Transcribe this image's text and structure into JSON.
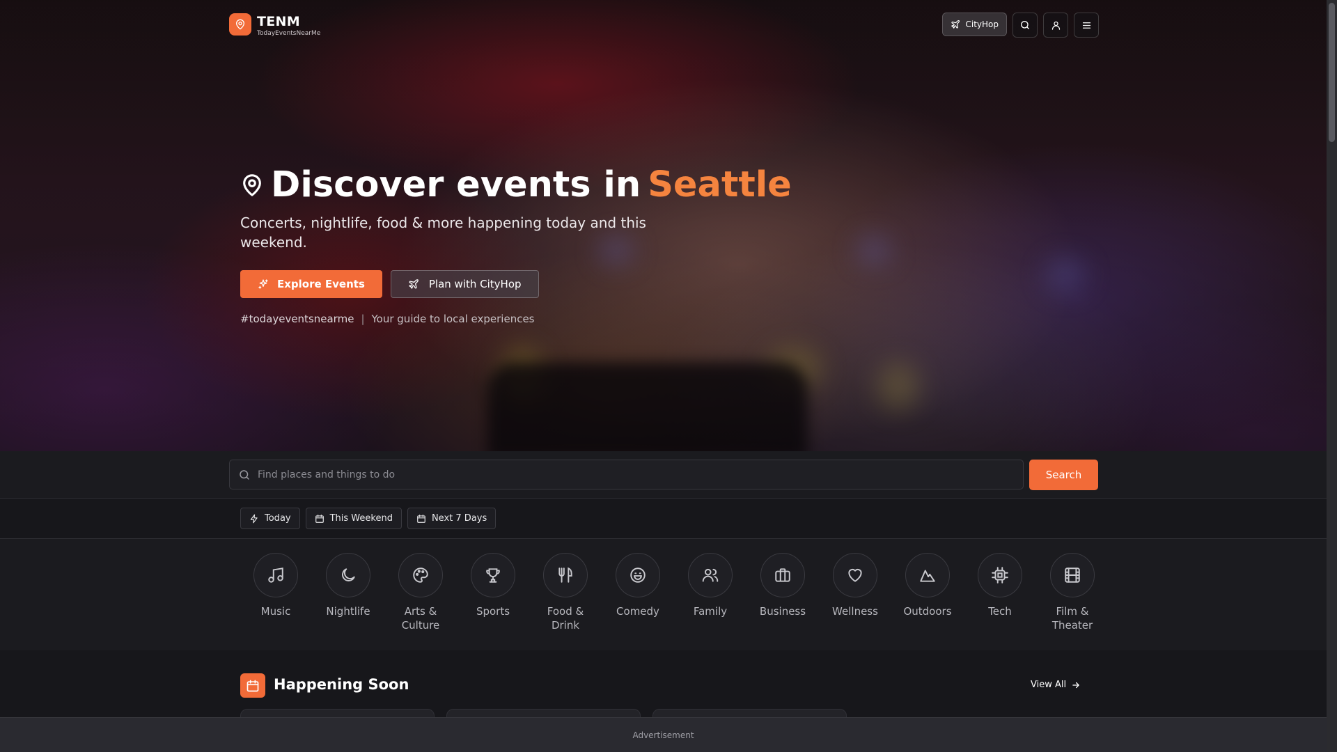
{
  "brand": {
    "name": "TENM",
    "tagline": "TodayEventsNearMe"
  },
  "header": {
    "cityhop_label": "CityHop"
  },
  "hero": {
    "title_prefix": "Discover events in",
    "city": "Seattle",
    "subtitle": "Concerts, nightlife, food & more happening today and this weekend.",
    "explore_label": "Explore Events",
    "plan_label": "Plan with CityHop",
    "hashtag": "#todayeventsnearme",
    "separator": "|",
    "guide_text": "Your guide to local experiences"
  },
  "search": {
    "placeholder": "Find places and things to do",
    "button_label": "Search"
  },
  "filters": [
    {
      "label": "Today",
      "icon": "lightning-icon"
    },
    {
      "label": "This Weekend",
      "icon": "calendar-icon"
    },
    {
      "label": "Next 7 Days",
      "icon": "calendar-icon"
    }
  ],
  "categories": [
    {
      "label": "Music",
      "icon": "music-note-icon"
    },
    {
      "label": "Nightlife",
      "icon": "moon-icon"
    },
    {
      "label": "Arts & Culture",
      "icon": "palette-icon"
    },
    {
      "label": "Sports",
      "icon": "trophy-icon"
    },
    {
      "label": "Food & Drink",
      "icon": "utensils-icon"
    },
    {
      "label": "Comedy",
      "icon": "laugh-icon"
    },
    {
      "label": "Family",
      "icon": "users-icon"
    },
    {
      "label": "Business",
      "icon": "briefcase-icon"
    },
    {
      "label": "Wellness",
      "icon": "heart-icon"
    },
    {
      "label": "Outdoors",
      "icon": "mountain-icon"
    },
    {
      "label": "Tech",
      "icon": "cpu-icon"
    },
    {
      "label": "Film & Theater",
      "icon": "film-icon"
    }
  ],
  "happening_soon": {
    "title": "Happening Soon",
    "view_all_label": "View All"
  },
  "ad": {
    "label": "Advertisement"
  },
  "colors": {
    "accent": "#f26b38",
    "city_highlight": "#f5843f",
    "background": "#17171b"
  }
}
